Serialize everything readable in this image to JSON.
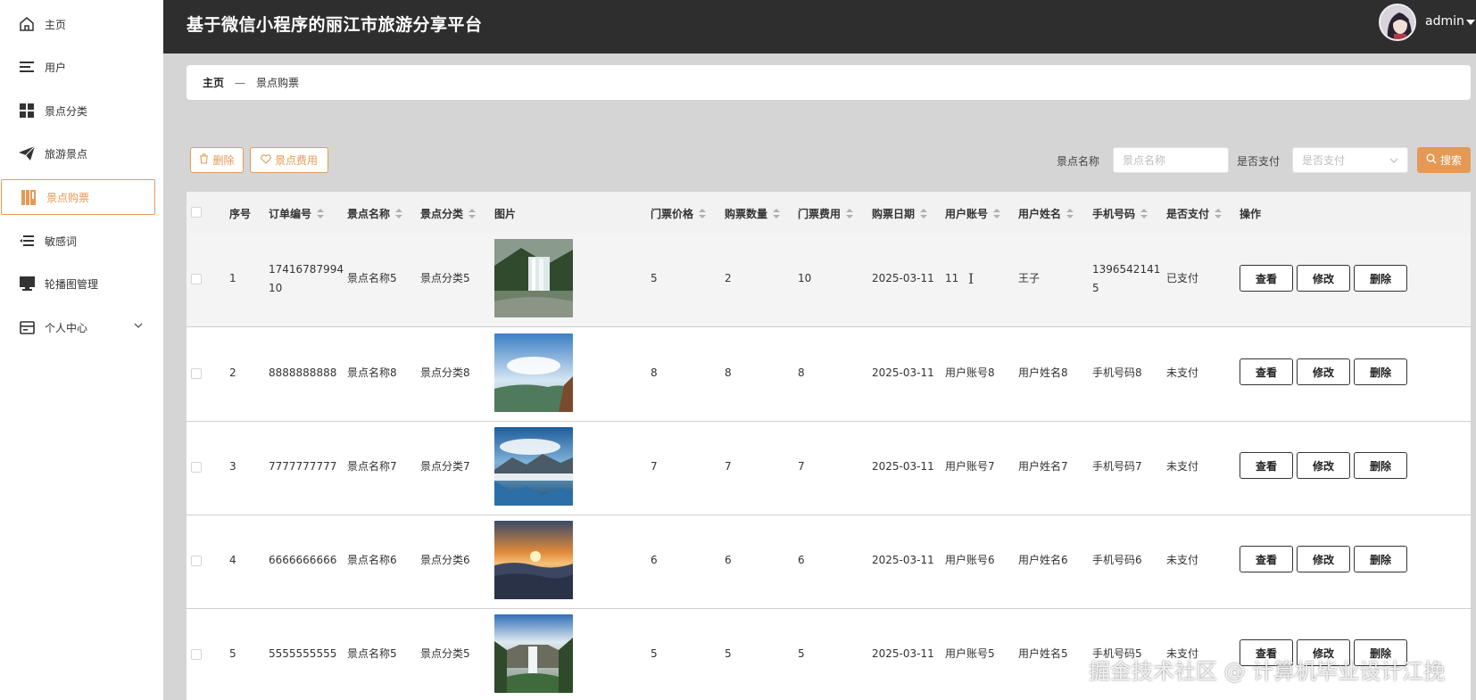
{
  "app": {
    "title": "基于微信小程序的丽江市旅游分享平台",
    "username": "admin"
  },
  "sidebar": {
    "items": [
      {
        "label": "主页",
        "icon": "home-icon"
      },
      {
        "label": "用户",
        "icon": "list-icon"
      },
      {
        "label": "景点分类",
        "icon": "grid-icon"
      },
      {
        "label": "旅游景点",
        "icon": "paper-plane-icon"
      },
      {
        "label": "景点购票",
        "icon": "book-icon",
        "active": true
      },
      {
        "label": "敏感词",
        "icon": "indent-list-icon"
      },
      {
        "label": "轮播图管理",
        "icon": "monitor-icon"
      },
      {
        "label": "个人中心",
        "icon": "id-card-icon",
        "expandable": true
      }
    ]
  },
  "breadcrumb": {
    "home": "主页",
    "separator": "—",
    "current": "景点购票"
  },
  "toolbar": {
    "delete_label": "删除",
    "fee_label": "景点费用",
    "filter_name_label": "景点名称",
    "filter_name_placeholder": "景点名称",
    "filter_paid_label": "是否支付",
    "filter_paid_placeholder": "是否支付",
    "search_label": "搜索"
  },
  "table": {
    "columns": [
      "序号",
      "订单编号",
      "景点名称",
      "景点分类",
      "图片",
      "门票价格",
      "购票数量",
      "门票费用",
      "购票日期",
      "用户账号",
      "用户姓名",
      "手机号码",
      "是否支付",
      "操作"
    ],
    "actions": {
      "view": "查看",
      "edit": "修改",
      "delete": "删除"
    },
    "rows": [
      {
        "index": "1",
        "order_no_line1": "17416787994",
        "order_no_line2": "10",
        "spot_name": "景点名称5",
        "category": "景点分类5",
        "price": "5",
        "qty": "2",
        "fee": "10",
        "date": "2025-03-11",
        "account": "11",
        "user_name": "王子",
        "phone_line1": "1396542141",
        "phone_line2": "5",
        "paid": "已支付"
      },
      {
        "index": "2",
        "order_no_line1": "8888888888",
        "order_no_line2": "",
        "spot_name": "景点名称8",
        "category": "景点分类8",
        "price": "8",
        "qty": "8",
        "fee": "8",
        "date": "2025-03-11",
        "account": "用户账号8",
        "user_name": "用户姓名8",
        "phone_line1": "手机号码8",
        "phone_line2": "",
        "paid": "未支付"
      },
      {
        "index": "3",
        "order_no_line1": "7777777777",
        "order_no_line2": "",
        "spot_name": "景点名称7",
        "category": "景点分类7",
        "price": "7",
        "qty": "7",
        "fee": "7",
        "date": "2025-03-11",
        "account": "用户账号7",
        "user_name": "用户姓名7",
        "phone_line1": "手机号码7",
        "phone_line2": "",
        "paid": "未支付"
      },
      {
        "index": "4",
        "order_no_line1": "6666666666",
        "order_no_line2": "",
        "spot_name": "景点名称6",
        "category": "景点分类6",
        "price": "6",
        "qty": "6",
        "fee": "6",
        "date": "2025-03-11",
        "account": "用户账号6",
        "user_name": "用户姓名6",
        "phone_line1": "手机号码6",
        "phone_line2": "",
        "paid": "未支付"
      },
      {
        "index": "5",
        "order_no_line1": "5555555555",
        "order_no_line2": "",
        "spot_name": "景点名称5",
        "category": "景点分类5",
        "price": "5",
        "qty": "5",
        "fee": "5",
        "date": "2025-03-11",
        "account": "用户账号5",
        "user_name": "用户姓名5",
        "phone_line1": "手机号码5",
        "phone_line2": "",
        "paid": "未支付"
      }
    ]
  },
  "watermark": "掘金技术社区 @ 计算机毕业设计江挽",
  "colors": {
    "accent": "#e49a55",
    "header_bg": "#2e2e2e",
    "page_bg": "#d5d5d5"
  }
}
